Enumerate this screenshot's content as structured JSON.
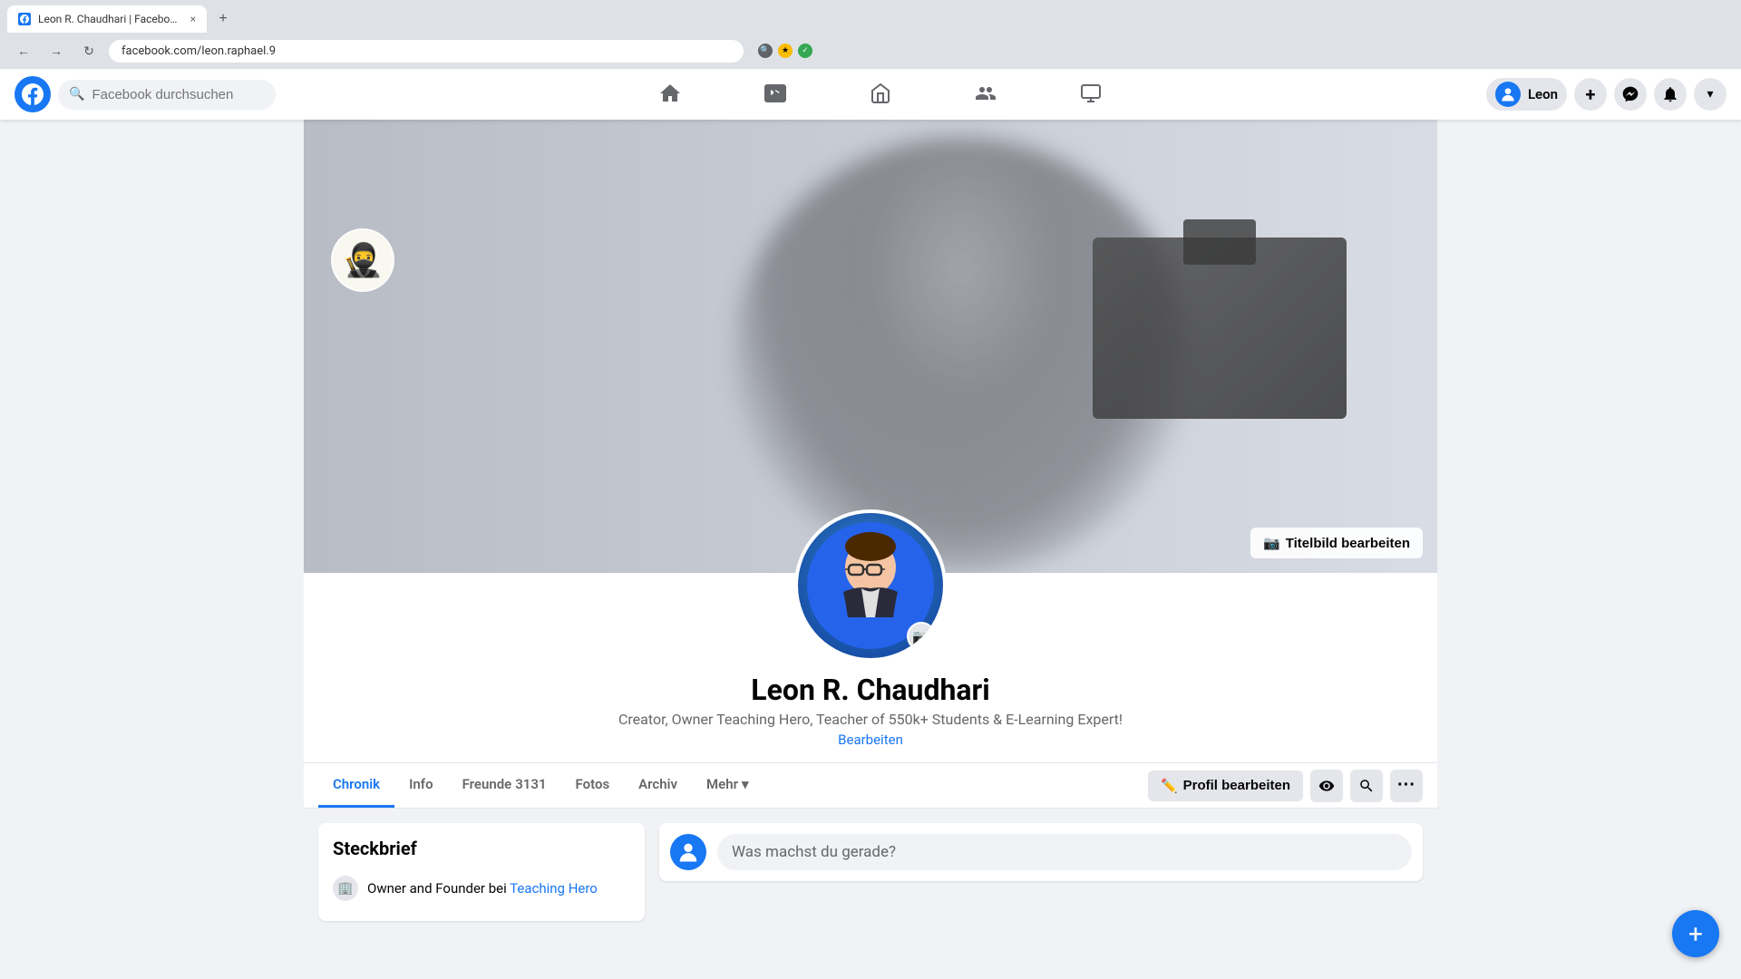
{
  "browser": {
    "tab_title": "Leon R. Chaudhari | Facebook",
    "tab_close": "×",
    "tab_new": "+",
    "address": "facebook.com/leon.raphael.9",
    "back_btn": "←",
    "forward_btn": "→",
    "refresh_btn": "↻"
  },
  "nav": {
    "search_placeholder": "Facebook durchsuchen",
    "user_name": "Leon",
    "add_btn": "+",
    "messenger_icon": "💬",
    "notifications_icon": "🔔",
    "menu_icon": "▾"
  },
  "profile": {
    "name": "Leon R. Chaudhari",
    "bio": "Creator, Owner Teaching Hero, Teacher of 550k+ Students & E-Learning Expert!",
    "edit_bio_label": "Bearbeiten",
    "edit_cover_label": "Titelbild bearbeiten",
    "tabs": [
      {
        "id": "chronik",
        "label": "Chronik",
        "active": true
      },
      {
        "id": "info",
        "label": "Info"
      },
      {
        "id": "freunde",
        "label": "Freunde"
      },
      {
        "id": "fotos",
        "label": "Fotos"
      },
      {
        "id": "archiv",
        "label": "Archiv"
      },
      {
        "id": "mehr",
        "label": "Mehr"
      }
    ],
    "friends_count": "3131",
    "mehr_icon": "▾",
    "actions": {
      "edit_profile": "Profil bearbeiten",
      "edit_icon": "✏️"
    }
  },
  "steckbrief": {
    "title": "Steckbrief",
    "items": [
      {
        "icon": "🏢",
        "text": "Owner and Founder bei Teaching Hero"
      }
    ]
  },
  "post_box": {
    "placeholder": "Was machst du gerade?"
  },
  "floating_btn": "+",
  "colors": {
    "brand": "#1877f2",
    "active_tab": "#1877f2",
    "bg": "#f0f2f5",
    "card_bg": "#ffffff",
    "text_primary": "#050505",
    "text_secondary": "#65676b"
  }
}
